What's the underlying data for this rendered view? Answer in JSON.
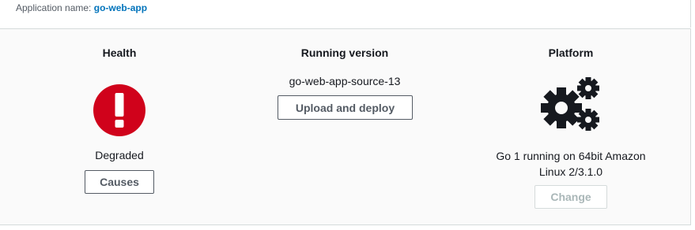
{
  "header": {
    "app_name_label": "Application name:",
    "app_name_value": "go-web-app"
  },
  "health": {
    "title": "Health",
    "icon": "exclamation-circle-icon",
    "status": "Degraded",
    "causes_label": "Causes",
    "color": "#d0021b"
  },
  "running_version": {
    "title": "Running version",
    "version": "go-web-app-source-13",
    "upload_label": "Upload and deploy"
  },
  "platform": {
    "title": "Platform",
    "icon": "gears-icon",
    "line1": "Go 1 running on 64bit Amazon",
    "line2": "Linux 2/3.1.0",
    "change_label": "Change"
  }
}
